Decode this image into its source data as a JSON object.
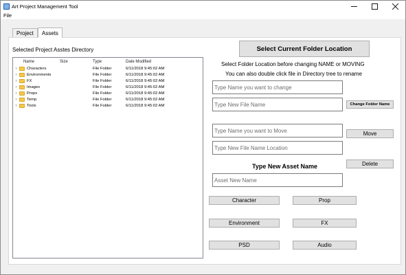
{
  "window": {
    "title": "Art Project Management Tool"
  },
  "menu": {
    "file": "File"
  },
  "tabs": [
    {
      "label": "Project"
    },
    {
      "label": "Assets"
    }
  ],
  "assets": {
    "section_label": "Selected Project Asstes Directory",
    "columns": [
      "Name",
      "Size",
      "Type",
      "Date Modified"
    ],
    "rows": [
      {
        "name": "Characters",
        "size": "",
        "type": "File Folder",
        "date": "6/11/2018 9:45:02 AM"
      },
      {
        "name": "Environments",
        "size": "",
        "type": "File Folder",
        "date": "6/11/2018 9:45:02 AM"
      },
      {
        "name": "FX",
        "size": "",
        "type": "File Folder",
        "date": "6/11/2018 9:45:02 AM"
      },
      {
        "name": "Images",
        "size": "",
        "type": "File Folder",
        "date": "6/11/2018 9:45:02 AM"
      },
      {
        "name": "Props",
        "size": "",
        "type": "File Folder",
        "date": "6/11/2018 9:45:02 AM"
      },
      {
        "name": "Temp",
        "size": "",
        "type": "File Folder",
        "date": "6/11/2018 9:45:02 AM"
      },
      {
        "name": "Tools",
        "size": "",
        "type": "File Folder",
        "date": "6/11/2018 9:45:02 AM"
      }
    ],
    "select_folder_button": "Select Current Folder Location",
    "instruction_1": "Select Folder Location before changing NAME or MOVING",
    "instruction_2": "You can also double click file in Directory tree to rename",
    "rename": {
      "current_name_placeholder": "Type Name you want to change",
      "new_name_placeholder": "Type New File Name",
      "button": "Change Folder Name"
    },
    "move": {
      "name_placeholder": "Type Name you want to Move",
      "location_placeholder": "Type New File Name Location",
      "button": "Move"
    },
    "delete_button": "Delete",
    "new_asset": {
      "heading": "Type New Asset Name",
      "placeholder": "Asset New Name",
      "buttons": [
        "Character",
        "Prop",
        "Environment",
        "FX",
        "PSD",
        "Audio"
      ]
    }
  }
}
